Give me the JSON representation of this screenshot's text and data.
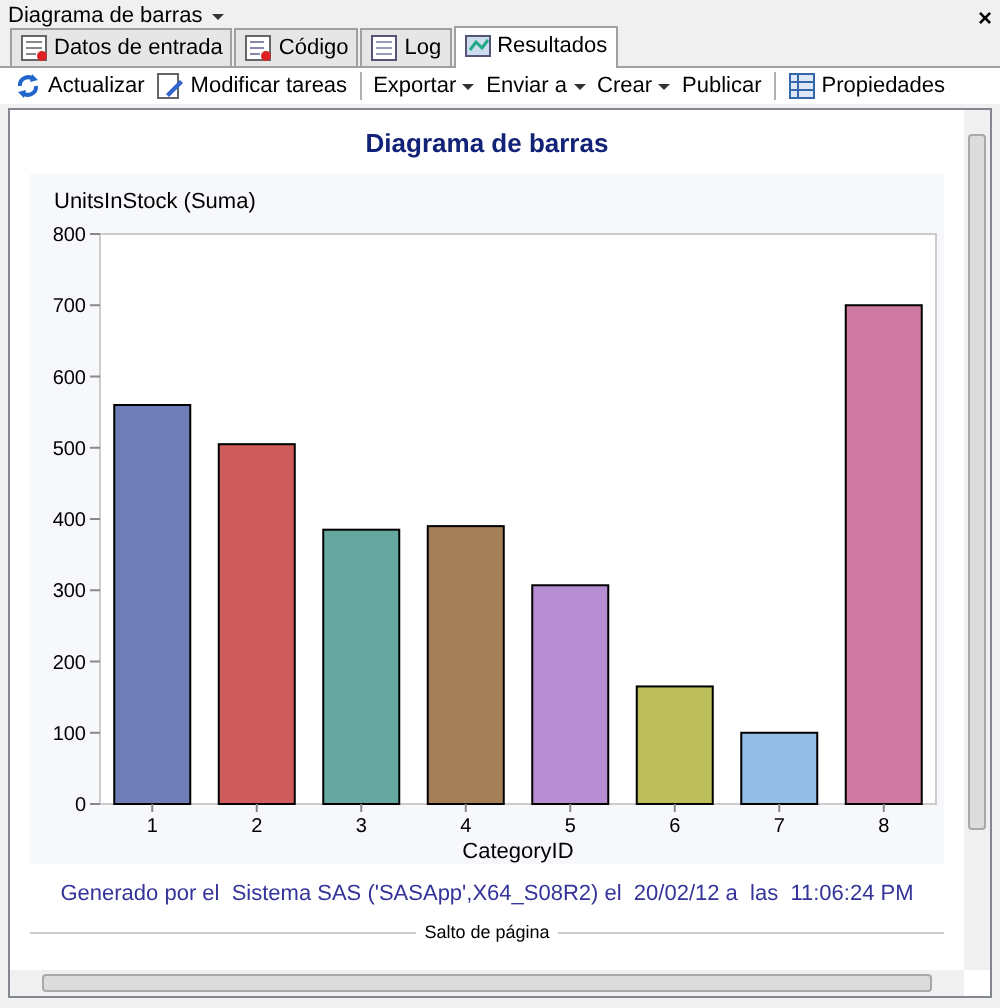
{
  "window": {
    "title": "Diagrama de barras",
    "close": "×"
  },
  "tabs": [
    {
      "label": "Datos de entrada",
      "selected": false
    },
    {
      "label": "Código",
      "selected": false
    },
    {
      "label": "Log",
      "selected": false
    },
    {
      "label": "Resultados",
      "selected": true
    }
  ],
  "toolbar": {
    "groups": [
      [
        {
          "label": "Actualizar",
          "kind": "icon"
        },
        {
          "label": "Modificar tareas",
          "kind": "icon"
        }
      ],
      [
        {
          "label": "Exportar",
          "kind": "menu"
        },
        {
          "label": "Enviar a",
          "kind": "menu"
        },
        {
          "label": "Crear",
          "kind": "menu"
        },
        {
          "label": "Publicar",
          "kind": "plain"
        }
      ],
      [
        {
          "label": "Propiedades",
          "kind": "icon"
        }
      ]
    ]
  },
  "report": {
    "title": "Diagrama de barras",
    "chart_data": {
      "type": "bar",
      "ylabel": "UnitsInStock (Suma)",
      "xlabel": "CategoryID",
      "categories": [
        "1",
        "2",
        "3",
        "4",
        "5",
        "6",
        "7",
        "8"
      ],
      "values": [
        560,
        505,
        385,
        390,
        307,
        165,
        100,
        700
      ],
      "colors": [
        "#6f7eb7",
        "#d05b5b",
        "#66a8a0",
        "#a57f57",
        "#b58dd0",
        "#bcbd5b",
        "#94bde6",
        "#cf7aa0"
      ],
      "ylim": [
        0,
        800
      ],
      "yticks": [
        0,
        100,
        200,
        300,
        400,
        500,
        600,
        700,
        800
      ]
    },
    "footer": "Generado por el  Sistema SAS ('SASApp',X64_S08R2) el  20/02/12 a  las  11:06:24 PM",
    "page_break": "Salto de página"
  }
}
